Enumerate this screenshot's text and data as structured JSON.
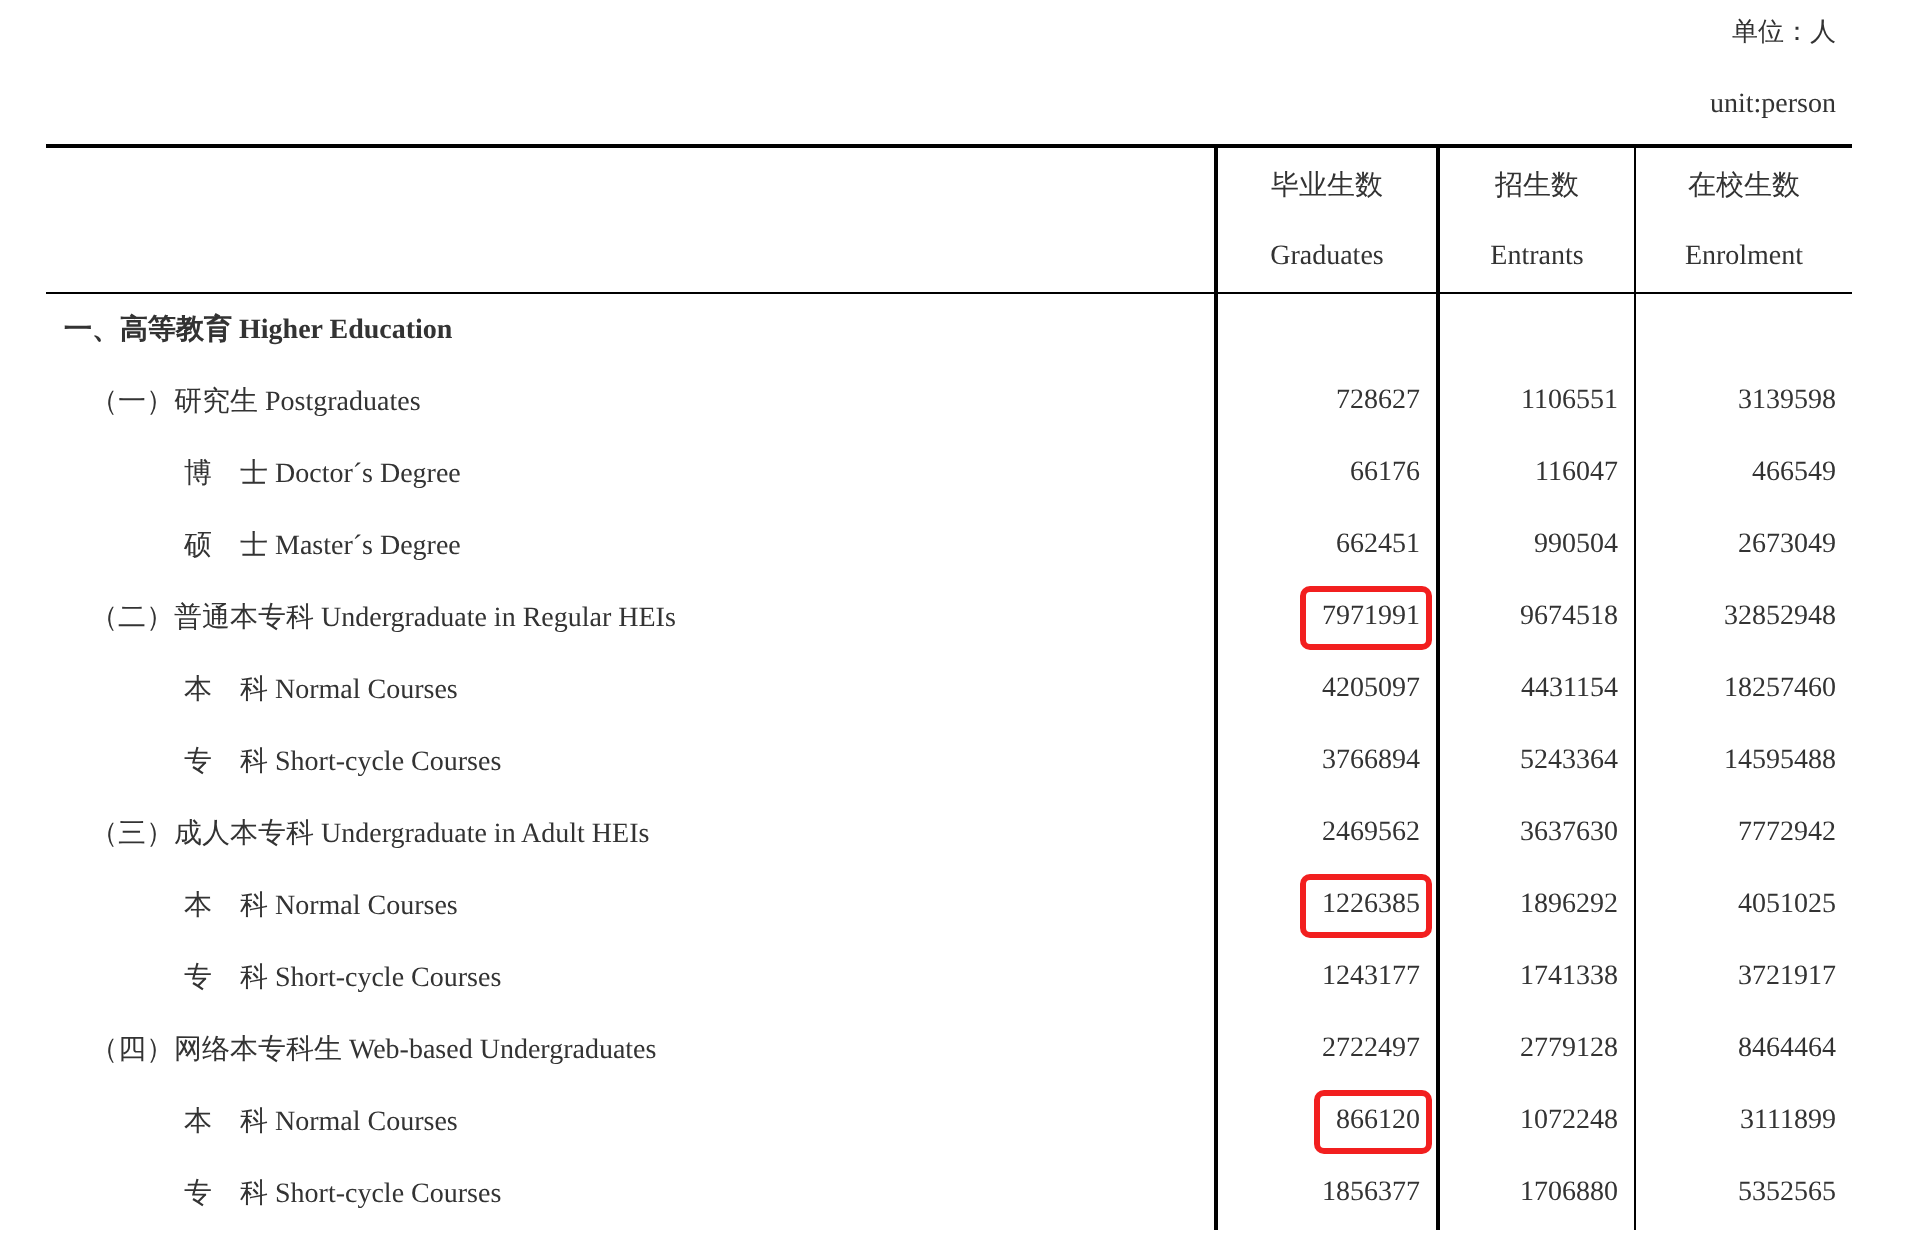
{
  "unit": {
    "chinese": "单位：人",
    "english": "unit:person"
  },
  "table": {
    "columns": [
      {
        "chinese": "毕业生数",
        "english": "Graduates"
      },
      {
        "chinese": "招生数",
        "english": "Entrants"
      },
      {
        "chinese": "在校生数",
        "english": "Enrolment"
      }
    ],
    "rows": [
      {
        "label": "一、高等教育 Higher Education",
        "children": [
          {
            "label": "（一）研究生 Postgraduates",
            "graduates": {
              "value": "728627",
              "highlighted": false
            },
            "entrants": "1106551",
            "enrolment": "3139598",
            "children": [
              {
                "label": "博　士 Doctor´s Degree",
                "graduates": {
                  "value": "66176",
                  "highlighted": false
                },
                "entrants": "116047",
                "enrolment": "466549"
              },
              {
                "label": "硕　士 Master´s Degree",
                "graduates": {
                  "value": "662451",
                  "highlighted": false
                },
                "entrants": "990504",
                "enrolment": "2673049"
              }
            ]
          },
          {
            "label": "（二）普通本专科 Undergraduate in Regular HEIs",
            "graduates": {
              "value": "7971991",
              "highlighted": true
            },
            "entrants": "9674518",
            "enrolment": "32852948",
            "children": [
              {
                "label": "本　科 Normal Courses",
                "graduates": {
                  "value": "4205097",
                  "highlighted": false
                },
                "entrants": "4431154",
                "enrolment": "18257460"
              },
              {
                "label": "专　科 Short-cycle Courses",
                "graduates": {
                  "value": "3766894",
                  "highlighted": false
                },
                "entrants": "5243364",
                "enrolment": "14595488"
              }
            ]
          },
          {
            "label": "（三）成人本专科 Undergraduate in Adult HEIs",
            "graduates": {
              "value": "2469562",
              "highlighted": false
            },
            "entrants": "3637630",
            "enrolment": "7772942",
            "children": [
              {
                "label": "本　科 Normal Courses",
                "graduates": {
                  "value": "1226385",
                  "highlighted": true
                },
                "entrants": "1896292",
                "enrolment": "4051025"
              },
              {
                "label": "专　科 Short-cycle Courses",
                "graduates": {
                  "value": "1243177",
                  "highlighted": false
                },
                "entrants": "1741338",
                "enrolment": "3721917"
              }
            ]
          },
          {
            "label": "（四）网络本专科生 Web-based Undergraduates",
            "graduates": {
              "value": "2722497",
              "highlighted": false
            },
            "entrants": "2779128",
            "enrolment": "8464464",
            "children": [
              {
                "label": "本　科 Normal Courses",
                "graduates": {
                  "value": "866120",
                  "highlighted": true
                },
                "entrants": "1072248",
                "enrolment": "3111899"
              },
              {
                "label": "专　科 Short-cycle Courses",
                "graduates": {
                  "value": "1856377",
                  "highlighted": false
                },
                "entrants": "1706880",
                "enrolment": "5352565"
              }
            ]
          }
        ]
      }
    ]
  }
}
